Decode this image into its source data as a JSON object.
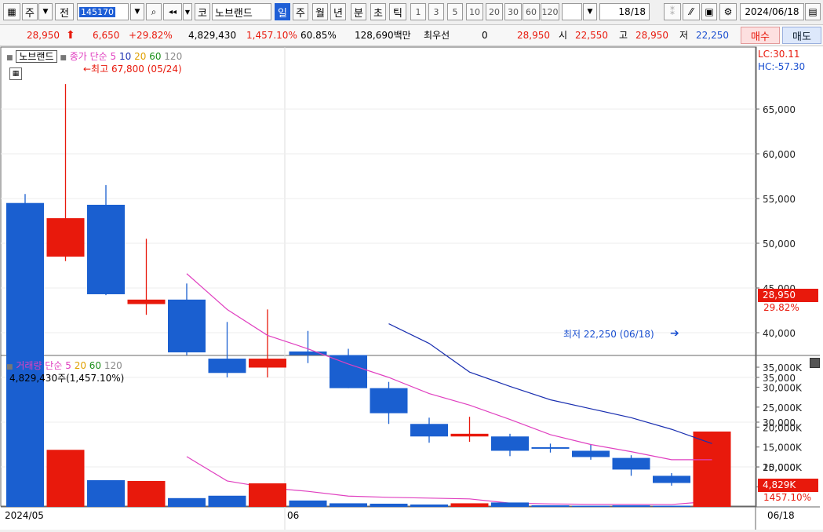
{
  "toolbar": {
    "market": "주",
    "prefix": "전",
    "code": "145170",
    "name": "노브랜드",
    "exchange": "코",
    "periods": [
      "일",
      "주",
      "월",
      "년",
      "분",
      "초",
      "틱"
    ],
    "intervals": [
      "1",
      "3",
      "5",
      "10",
      "20",
      "30",
      "60",
      "120"
    ],
    "page": "18",
    "page_total": "/18",
    "date": "2024/06/18"
  },
  "quote": {
    "price": "28,950",
    "change": "6,650",
    "change_pct": "+29.82%",
    "volume": "4,829,430",
    "volume_pct": "1,457.10%",
    "turnover_pct": "60.85%",
    "amount": "128,690백만",
    "best_label": "최우선",
    "best_value": "0",
    "last": "28,950",
    "open_label": "시",
    "open": "22,550",
    "high_label": "고",
    "high": "28,950",
    "low_label": "저",
    "low": "22,250",
    "buy_label": "매수",
    "sell_label": "매도"
  },
  "price_panel": {
    "stock_tag": "노브랜드",
    "ma_legend": {
      "label": "종가 단순",
      "periods": [
        "5",
        "10",
        "20",
        "60",
        "120"
      ]
    },
    "max_annotation": "←최고 67,800 (05/24)",
    "min_annotation": "최저 22,250 (06/18)",
    "lc": "LC:30.11",
    "hc": "HC:-57.30",
    "y_ticks": [
      "65,000",
      "60,000",
      "55,000",
      "50,000",
      "45,000",
      "40,000",
      "35,000",
      "30,000",
      "25,000"
    ],
    "last_price_tag": "28,950",
    "last_pct_tag": "29.82%"
  },
  "volume_panel": {
    "ma_legend": {
      "label": "거래량",
      "sub": "단순",
      "periods": [
        "5",
        "20",
        "60",
        "120"
      ]
    },
    "info": "4,829,430주(1,457.10%)",
    "y_ticks": [
      "35,000K",
      "30,000K",
      "25,000K",
      "20,000K",
      "15,000K",
      "10,000K",
      "5,000K"
    ],
    "last_vol_tag": "4,829K",
    "last_pct_tag": "1457.10%"
  },
  "x_axis": {
    "start": "2024/05",
    "mid": "06",
    "end": "06/18"
  },
  "colors": {
    "up": "#e8190c",
    "down": "#1a5fd0",
    "ma5": "#e040c0",
    "ma10": "#1a2fb0"
  },
  "chart_data": {
    "type": "candlestick",
    "candles": [
      {
        "o": 54500,
        "h": 55500,
        "l": 30600,
        "c": 30800,
        "v": 33500
      },
      {
        "o": 48500,
        "h": 67800,
        "l": 48000,
        "c": 52800,
        "v": 14300
      },
      {
        "o": 54300,
        "h": 56500,
        "l": 44200,
        "c": 44300,
        "v": 6700
      },
      {
        "o": 43200,
        "h": 50500,
        "l": 42000,
        "c": 43700,
        "v": 6500
      },
      {
        "o": 43700,
        "h": 45500,
        "l": 37500,
        "c": 37800,
        "v": 2200
      },
      {
        "o": 37100,
        "h": 41200,
        "l": 35000,
        "c": 35500,
        "v": 2800
      },
      {
        "o": 36100,
        "h": 42600,
        "l": 35000,
        "c": 37100,
        "v": 5900
      },
      {
        "o": 37900,
        "h": 40200,
        "l": 36600,
        "c": 37500,
        "v": 1600
      },
      {
        "o": 37500,
        "h": 38200,
        "l": 33800,
        "c": 33800,
        "v": 900
      },
      {
        "o": 33800,
        "h": 34500,
        "l": 29800,
        "c": 31000,
        "v": 800
      },
      {
        "o": 29800,
        "h": 30500,
        "l": 27700,
        "c": 28400,
        "v": 600
      },
      {
        "o": 28400,
        "h": 30600,
        "l": 27800,
        "c": 28700,
        "v": 900
      },
      {
        "o": 28400,
        "h": 28700,
        "l": 26200,
        "c": 26800,
        "v": 1100
      },
      {
        "o": 27200,
        "h": 27600,
        "l": 26600,
        "c": 27100,
        "v": 400
      },
      {
        "o": 26800,
        "h": 27500,
        "l": 25800,
        "c": 26100,
        "v": 300
      },
      {
        "o": 26000,
        "h": 26300,
        "l": 24000,
        "c": 24700,
        "v": 400
      },
      {
        "o": 24000,
        "h": 24300,
        "l": 22900,
        "c": 23200,
        "v": 300
      },
      {
        "o": 22550,
        "h": 28950,
        "l": 22250,
        "c": 28950,
        "v": 4829
      }
    ],
    "ma5": [
      null,
      null,
      null,
      null,
      46600,
      42600,
      39700,
      38200,
      36500,
      35000,
      33200,
      31900,
      30300,
      28600,
      27500,
      26700,
      25800,
      25800
    ],
    "ma10": [
      null,
      null,
      null,
      null,
      null,
      null,
      null,
      null,
      null,
      41000,
      38800,
      35600,
      34000,
      32500,
      31500,
      30500,
      29200,
      27600
    ],
    "vol_ma5": [
      null,
      null,
      null,
      null,
      12600,
      6500,
      4800,
      3900,
      2700,
      2400,
      2200,
      2000,
      950,
      750,
      650,
      650,
      600,
      1400
    ],
    "price_ylim": [
      20000,
      70000
    ],
    "volume_ylim": [
      0,
      35000
    ],
    "volume_unit": "K"
  }
}
